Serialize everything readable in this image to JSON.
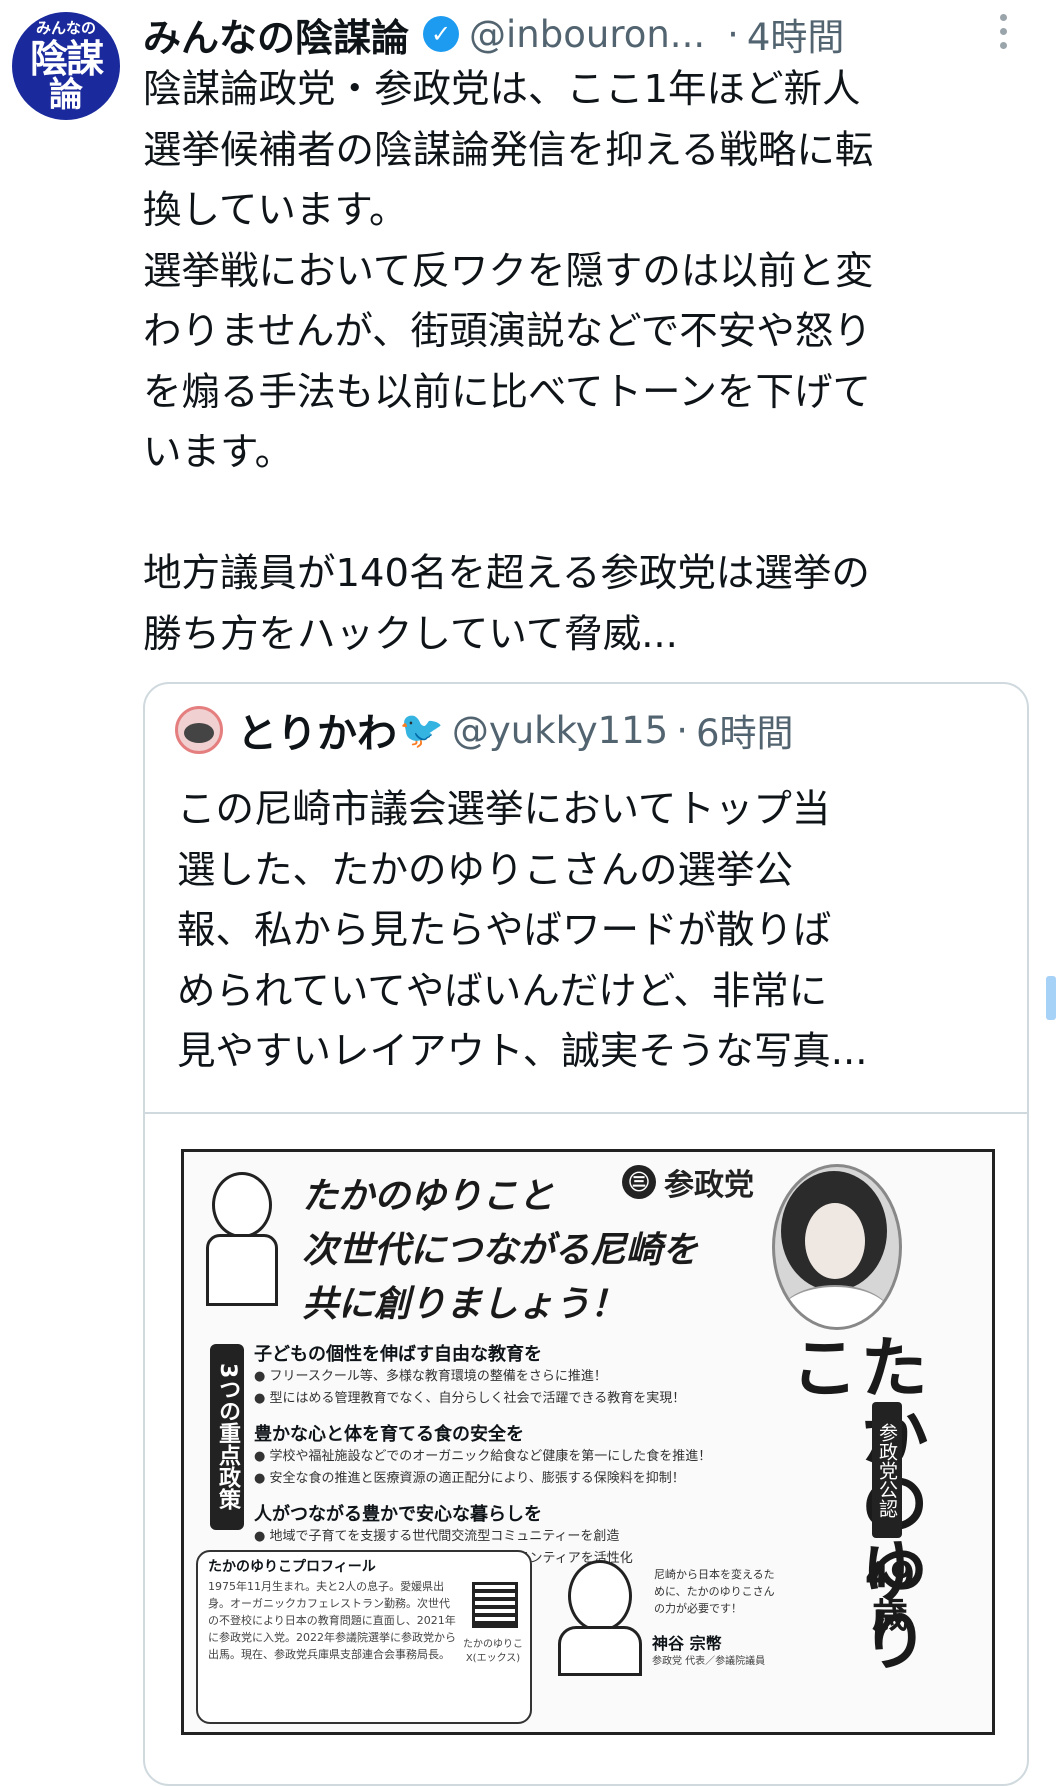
{
  "tweet": {
    "avatar_text": [
      "みんなの",
      "陰謀",
      "論"
    ],
    "display_name": "みんなの陰謀論",
    "verified_glyph": "✓",
    "handle": "@inbouron...",
    "separator": "·",
    "time": "4時間",
    "more_icon": "more-vertical-icon",
    "text": "陰謀論政党・参政党は、ここ1年ほど新人\n選挙候補者の陰謀論発信を抑える戦略に転\n換しています。\n選挙戦において反ワクを隠すのは以前と変\nわりませんが、街頭演説などで不安や怒り\nを煽る手法も以前に比べてトーンを下げて\nいます。\n\n地方議員が140名を超える参政党は選挙の\n勝ち方をハックしていて脅威..."
  },
  "quote": {
    "display_name": "とりかわ",
    "name_icon": "🐦",
    "handle": "@yukky115",
    "separator": "·",
    "time": "6時間",
    "text": "この尼崎市議会選挙においてトップ当\n選した、たかのゆりこさんの選挙公\n報、私から見たらやばワードが散りば\nめられていてやばいんだけど、非常に\n見やすいレイアウト、誠実そうな写真..."
  },
  "flyer": {
    "headline": "たかのゆりこと\n次世代につながる尼崎を\n共に創りましょう！",
    "party_logo": "㊂",
    "party_name": "参政党",
    "side_label": "3つの重点政策",
    "policies": [
      {
        "head": "子どもの個性を伸ばす自由な教育を",
        "items": [
          "● フリースクール等、多様な教育環境の整備をさらに推進！",
          "● 型にはめる管理教育でなく、自分らしく社会で活躍できる教育を実現！"
        ]
      },
      {
        "head": "豊かな心と体を育てる食の安全を",
        "items": [
          "● 学校や福祉施設などでのオーガニック給食など健康を第一にした食を推進！",
          "● 安全な食の推進と医療資源の適正配分により、膨張する保険料を抑制！"
        ]
      },
      {
        "head": "人がつながる豊かで安心な暮らしを",
        "items": [
          "● 地域で子育てを支援する世代間交流型コミュニティーを創造",
          "● 地域通貨あまさきコインを活用し、地域ボランティアを活性化"
        ]
      }
    ],
    "candidate_name": "たかのゆりこ",
    "endorsement": "参政党公認",
    "age": "49\n歳",
    "profile_title": "たかのゆりこプロフィール",
    "profile_text": "1975年11月生まれ。夫と2人の息子。愛媛県出身。オーガニックカフェレストラン勤務。次世代の不登校により日本の教育問題に直面し、2021年に参政党に入党。2022年参議院選挙に参政党から出馬。現在、参政党兵庫県支部連合会事務局長。",
    "qr_label": "たかのゆりこ X(エックス)",
    "kamiya_message": "尼崎から日本を変えるために、たかのゆりこさんの力が必要です！",
    "kamiya_name": "神谷 宗幣",
    "kamiya_role": "参政党 代表／参議院議員"
  }
}
